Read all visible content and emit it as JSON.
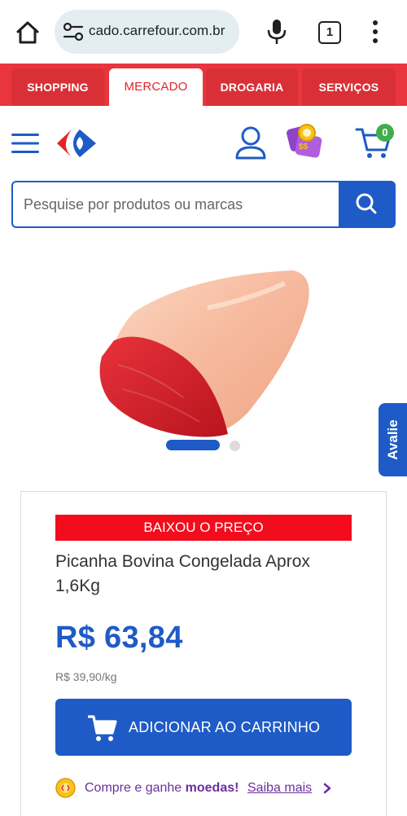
{
  "browser": {
    "url": "cado.carrefour.com.br",
    "tab_count": "1"
  },
  "categories": [
    {
      "label": "SHOPPING",
      "active": false
    },
    {
      "label": "MERCADO",
      "active": true
    },
    {
      "label": "DROGARIA",
      "active": false
    },
    {
      "label": "SERVIÇOS",
      "active": false
    }
  ],
  "header": {
    "cart_count": "0"
  },
  "search": {
    "placeholder": "Pesquise por produtos ou marcas"
  },
  "carousel": {
    "active_index": 1,
    "total": 2
  },
  "side_tab": {
    "label": "Avalie"
  },
  "product": {
    "badge": "BAIXOU O PREÇO",
    "name": "Picanha Bovina Congelada Aprox 1,6Kg",
    "price": "R$ 63,84",
    "price_per_kg": "R$ 39,90/kg",
    "add_to_cart_label": "ADICIONAR AO CARRINHO"
  },
  "coins_promo": {
    "text_prefix": "Compre e ganhe ",
    "text_bold": "moedas!",
    "link_label": "Saiba mais"
  },
  "colors": {
    "brand_blue": "#1e5bc6",
    "brand_red": "#e8353e",
    "promo_red": "#f20c1c",
    "promo_purple": "#6b2fa0",
    "badge_green": "#3fae4a"
  },
  "icons": [
    "home-icon",
    "tune-icon",
    "mic-icon",
    "tabs-icon",
    "more-vert-icon",
    "hamburger-icon",
    "carrefour-logo",
    "user-icon",
    "coins-icon",
    "cart-icon",
    "search-icon",
    "cart-add-icon",
    "coin-icon",
    "chevron-right-icon"
  ]
}
